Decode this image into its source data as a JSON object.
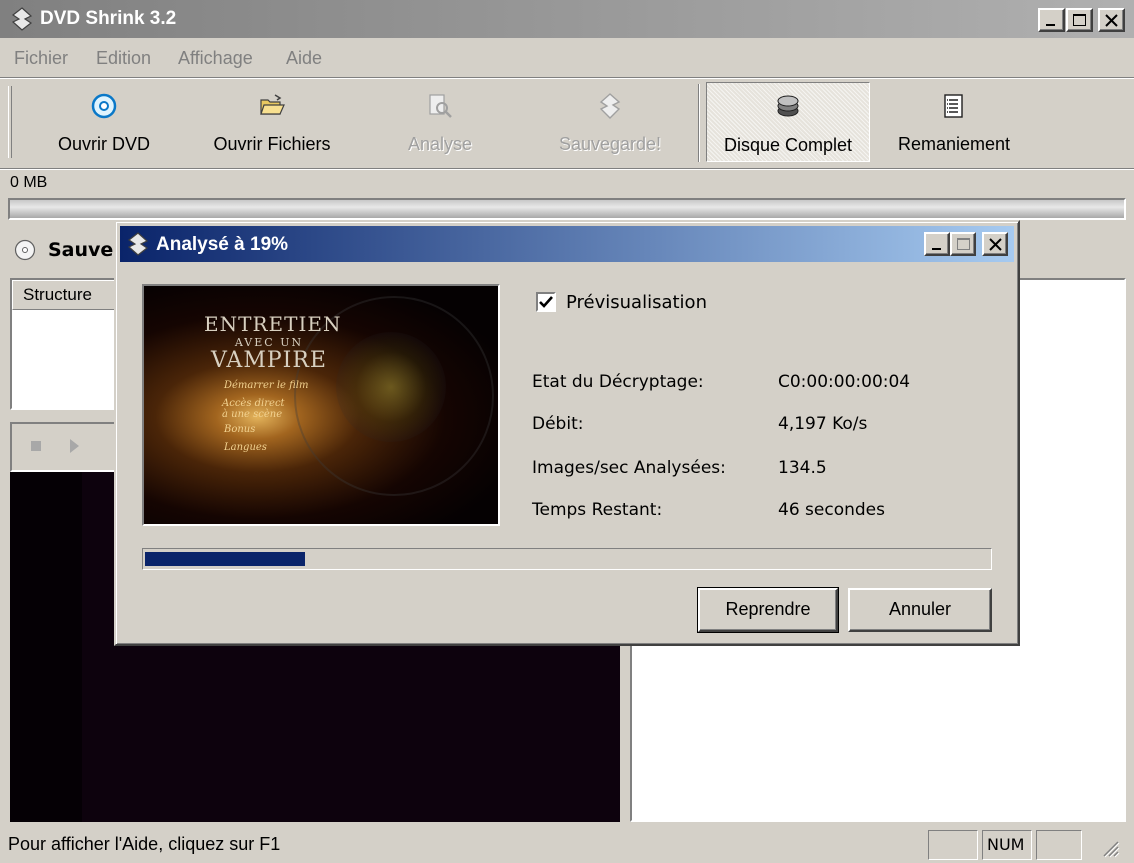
{
  "app": {
    "title": "DVD Shrink 3.2"
  },
  "menu": [
    "Fichier",
    "Edition",
    "Affichage",
    "Aide"
  ],
  "toolbar": {
    "open_dvd": "Ouvrir DVD",
    "open_files": "Ouvrir Fichiers",
    "analyze": "Analyse",
    "backup": "Sauvegarde!",
    "full_disc": "Disque Complet",
    "reauthor": "Remaniement"
  },
  "size_label": "0 MB",
  "left_panel": {
    "tab_label": "Sauve",
    "structure_header": "Structure"
  },
  "status_bar": {
    "help_text": "Pour afficher l'Aide, cliquez sur F1",
    "num": "NUM"
  },
  "dialog": {
    "title": "Analysé à 19%",
    "preview_checkbox_label": "Prévisualisation",
    "preview_checked": true,
    "preview_title": [
      "ENTRETIEN",
      "AVEC UN",
      "VAMPIRE"
    ],
    "preview_menu": [
      "Démarrer le film",
      "Accès direct à une scène",
      "Bonus",
      "Langues"
    ],
    "rows": [
      {
        "label": "Etat du Décryptage:",
        "value": "C0:00:00:00:04"
      },
      {
        "label": "Débit:",
        "value": "4,197 Ko/s"
      },
      {
        "label": "Images/sec Analysées:",
        "value": "134.5"
      },
      {
        "label": "Temps Restant:",
        "value": "46 secondes"
      }
    ],
    "progress_percent": 19,
    "resume_button": "Reprendre",
    "cancel_button": "Annuler"
  },
  "colors": {
    "dialog_title_active": "#0a246a",
    "window_title_inactive": "#808080",
    "progress_fill": "#0a246a"
  }
}
